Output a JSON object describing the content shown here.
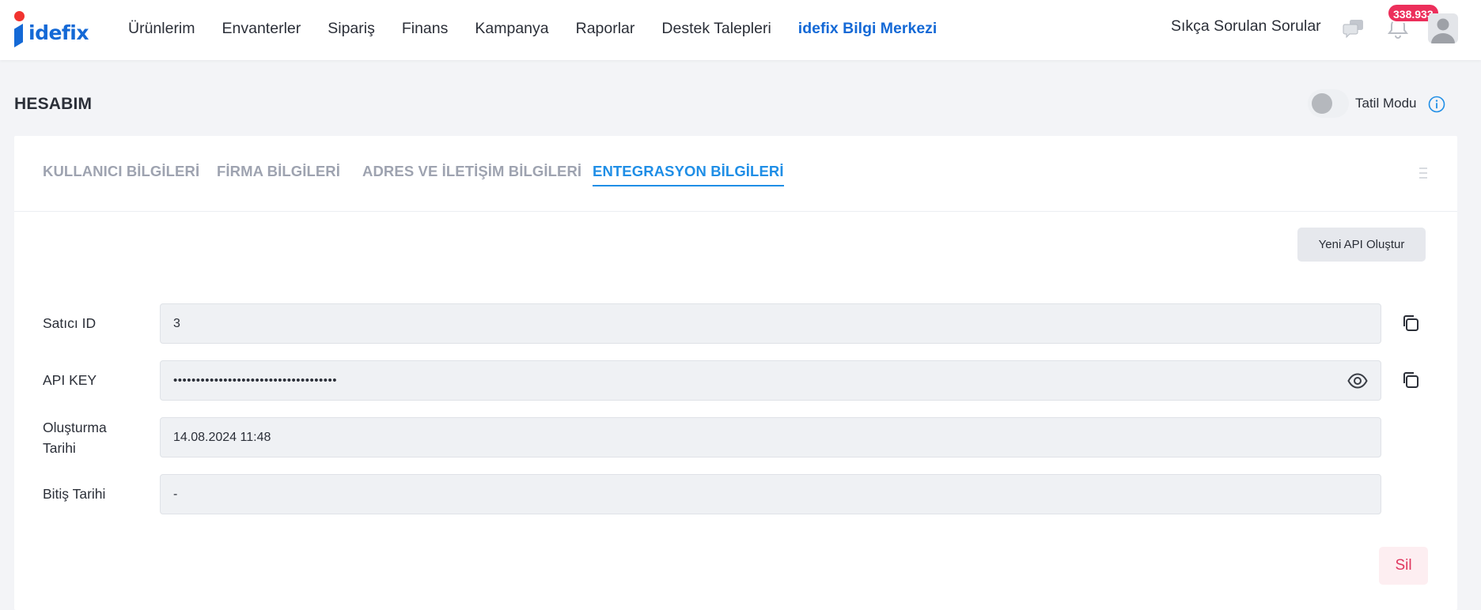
{
  "logo": {
    "text": "idefix",
    "brand_color": "#1469d6",
    "dot_color": "#f1332f"
  },
  "nav": {
    "items": [
      {
        "label": "Ürünlerim"
      },
      {
        "label": "Envanterler"
      },
      {
        "label": "Sipariş"
      },
      {
        "label": "Finans"
      },
      {
        "label": "Kampanya"
      },
      {
        "label": "Raporlar"
      },
      {
        "label": "Destek Talepleri"
      },
      {
        "label": "idefix Bilgi Merkezi"
      }
    ],
    "faq_label": "Sıkça Sorulan Sorular",
    "notification_count": "338.933",
    "icons": [
      "chat-icon",
      "bell-icon",
      "avatar-icon"
    ]
  },
  "page": {
    "title": "HESABIM",
    "vacation_mode_label": "Tatil Modu",
    "vacation_mode_on": false
  },
  "tabs": [
    {
      "label": "KULLANICI BİLGİLERİ",
      "active": false
    },
    {
      "label": "FİRMA BİLGİLERİ",
      "active": false
    },
    {
      "label": "ADRES VE İLETİŞİM BİLGİLERİ",
      "active": false
    },
    {
      "label": "ENTEGRASYON BİLGİLERİ",
      "active": true
    }
  ],
  "integration": {
    "new_api_label": "Yeni API Oluştur",
    "fields": [
      {
        "label": "Satıcı ID",
        "value": "3"
      },
      {
        "label": "API KEY",
        "value": "••••••••••••••••••••••••••••••••••••"
      },
      {
        "label": "Oluşturma Tarihi",
        "value": "14.08.2024 11:48"
      },
      {
        "label": "Bitiş Tarihi",
        "value": "-"
      }
    ],
    "delete_label": "Sil"
  },
  "colors": {
    "accent": "#1f8ee6",
    "badge": "#ec2f5b",
    "danger": "#e0365e"
  }
}
